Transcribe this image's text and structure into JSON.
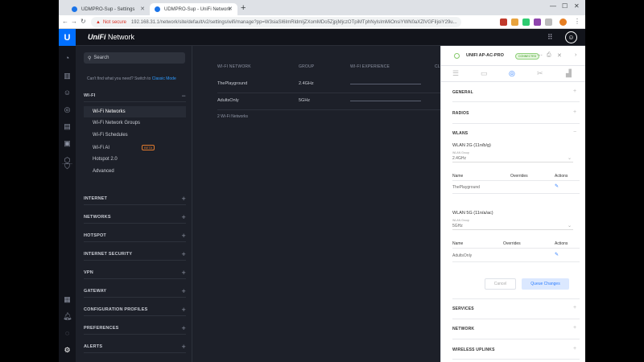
{
  "browser": {
    "tabs": [
      {
        "title": "UDMPRO-Sup - Settings"
      },
      {
        "title": "UDMPRO-Sup - UniFi Network"
      }
    ],
    "new_tab": "+",
    "security_warning": "Not secure",
    "url": "192.168.31.1/network/site/default/v2/settings/wifi/manage?pp=W3siaSI6ImRldmljZXomMDo5ZjpjMjczOTpiMTphNyIsImMiOnsiYWN0aXZlVGFiIjoiY29u..."
  },
  "app": {
    "brand": "UniFi",
    "brand_suffix": "Network",
    "logo_letter": "U",
    "avatar_letter": "☺"
  },
  "sidebar": {
    "search_placeholder": "Search",
    "cant_find": "Can't find what you need? Switch to",
    "classic_mode": "Classic Mode",
    "wifi_section": "WI-FI",
    "wifi_items": [
      {
        "label": "Wi-Fi Networks"
      },
      {
        "label": "Wi-Fi Network Groups"
      },
      {
        "label": "Wi-Fi Schedules"
      },
      {
        "label": "Wi-Fi AI",
        "badge": "BETA"
      },
      {
        "label": "Hotspot 2.0"
      },
      {
        "label": "Advanced"
      }
    ],
    "sections": [
      {
        "label": "INTERNET"
      },
      {
        "label": "NETWORKS"
      },
      {
        "label": "HOTSPOT"
      },
      {
        "label": "INTERNET SECURITY"
      },
      {
        "label": "VPN"
      },
      {
        "label": "GATEWAY"
      },
      {
        "label": "CONFIGURATION PROFILES"
      },
      {
        "label": "PREFERENCES"
      },
      {
        "label": "ALERTS"
      }
    ]
  },
  "main": {
    "columns": [
      "WI-FI NETWORK",
      "GROUP",
      "WI-FI EXPERIENCE",
      "CL"
    ],
    "rows": [
      {
        "name": "ThePlayground",
        "group": "2.4GHz"
      },
      {
        "name": "AdultsOnly",
        "group": "5GHz"
      }
    ],
    "count_label": "2 Wi-Fi Networks"
  },
  "panel": {
    "device_name": "UNIFI AP-AC-PRO",
    "status": "CONNECTED",
    "sections_top": [
      "GENERAL",
      "RADIOS",
      "WLANS"
    ],
    "wlans": [
      {
        "title": "WLAN 2G (11n/b/g)",
        "group_label": "WLAN Group",
        "group_value": "2.4GHz",
        "headers": [
          "Name",
          "Overrides",
          "Actions"
        ],
        "row_name": "ThePlayground"
      },
      {
        "title": "WLAN 5G (11n/a/ac)",
        "group_label": "WLAN Group",
        "group_value": "5GHz",
        "headers": [
          "Name",
          "Overrides",
          "Actions"
        ],
        "row_name": "AdultsOnly"
      }
    ],
    "cancel_label": "Cancel",
    "queue_label": "Queue Changes",
    "sections_bottom": [
      "SERVICES",
      "NETWORK",
      "WIRELESS UPLINKS"
    ]
  },
  "colors": {
    "accent": "#006fff",
    "link": "#2f9bff",
    "background": "#1d2029",
    "header": "#12141b"
  }
}
